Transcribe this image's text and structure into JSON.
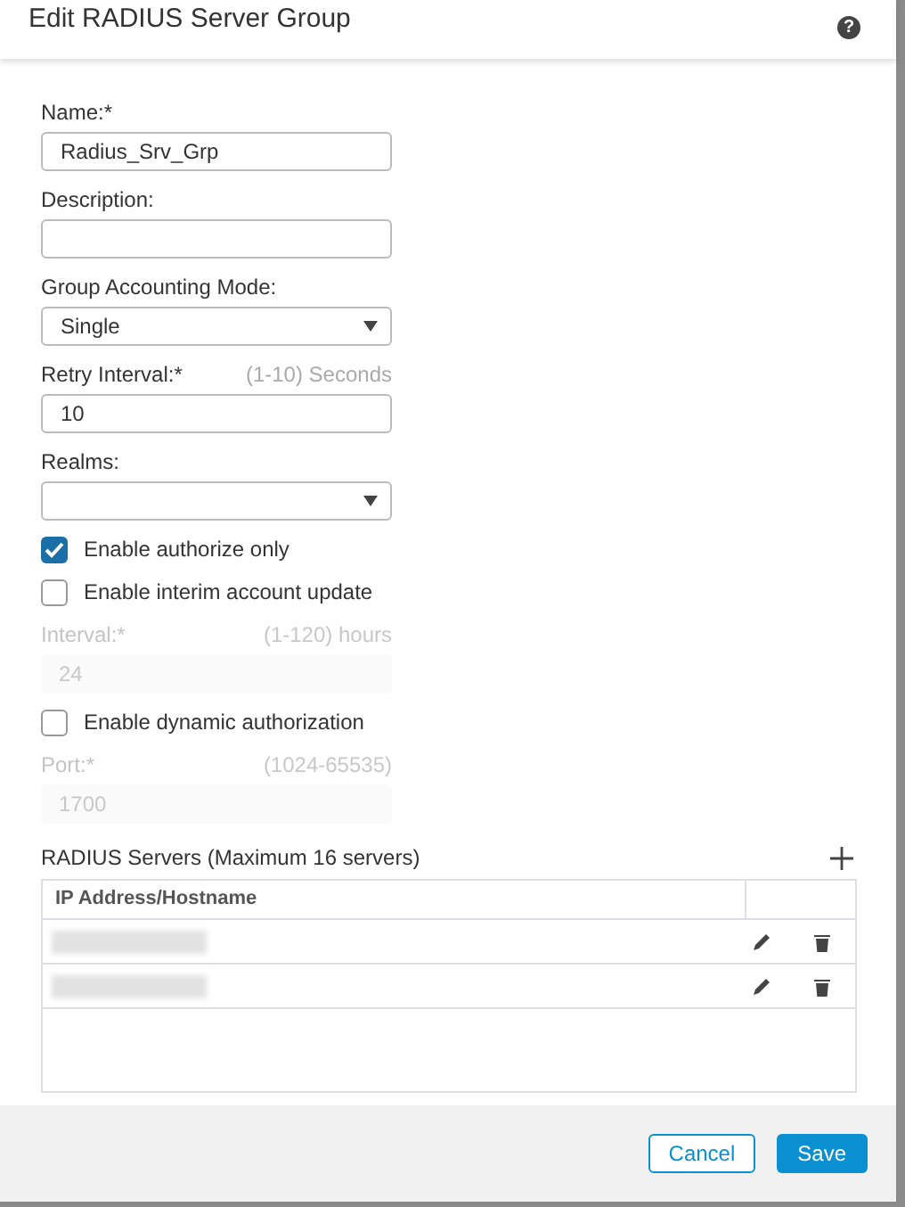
{
  "dialog": {
    "title": "Edit RADIUS Server Group",
    "help_icon": "?"
  },
  "form": [
    {
      "kind": "text",
      "label": "Name:*",
      "value": "Radius_Srv_Grp",
      "disabled": false
    },
    {
      "kind": "text",
      "label": "Description:",
      "disabled": false
    },
    {
      "kind": "select",
      "label": "Group Accounting Mode:",
      "value": "Single",
      "disabled": false
    },
    {
      "kind": "text",
      "label": "Retry Interval:*",
      "hint": "(1-10) Seconds",
      "value": "10",
      "disabled": false
    },
    {
      "kind": "select",
      "label": "Realms:",
      "disabled": false
    },
    {
      "kind": "check",
      "label": "Enable authorize only",
      "checked": true
    },
    {
      "kind": "check",
      "label": "Enable interim account update",
      "checked": false
    },
    {
      "kind": "text",
      "label": "Interval:*",
      "hint": "(1-120) hours",
      "value": "24",
      "disabled": true
    },
    {
      "kind": "check",
      "label": "Enable dynamic authorization",
      "checked": false
    },
    {
      "kind": "text",
      "label": "Port:*",
      "hint": "(1024-65535)",
      "value": "1700",
      "disabled": true
    }
  ],
  "servers": {
    "title": "RADIUS Servers (Maximum 16 servers)",
    "columns": [
      "IP Address/Hostname"
    ],
    "rows": [
      {
        "kind": "redacted"
      },
      {
        "kind": "redacted"
      }
    ]
  },
  "buttons": [
    {
      "label": "Cancel",
      "kind": "secondary"
    },
    {
      "label": "Save",
      "kind": "primary"
    }
  ]
}
